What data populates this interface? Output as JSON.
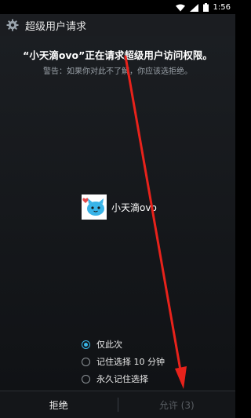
{
  "status_bar": {
    "time": "1:56",
    "icons": [
      "wifi-icon",
      "signal-icon",
      "battery-icon"
    ]
  },
  "header": {
    "icon": "gear-icon",
    "title": "超级用户请求"
  },
  "dialog": {
    "request_text": "“小天滴ovo”正在请求超级用户访问权限。",
    "warning_text": "警告：如果你对此不了解，你应该选拒绝。",
    "app": {
      "name": "小天滴ovo",
      "icon": "cat-mascot-icon"
    },
    "options": [
      {
        "label": "仅此次",
        "checked": true
      },
      {
        "label": "记住选择 10 分钟",
        "checked": false
      },
      {
        "label": "永久记住选择",
        "checked": false
      }
    ]
  },
  "buttons": {
    "deny_label": "拒绝",
    "allow_label": "允许 (3)"
  },
  "colors": {
    "accent": "#39b6e6",
    "annotation": "#e8221b"
  }
}
